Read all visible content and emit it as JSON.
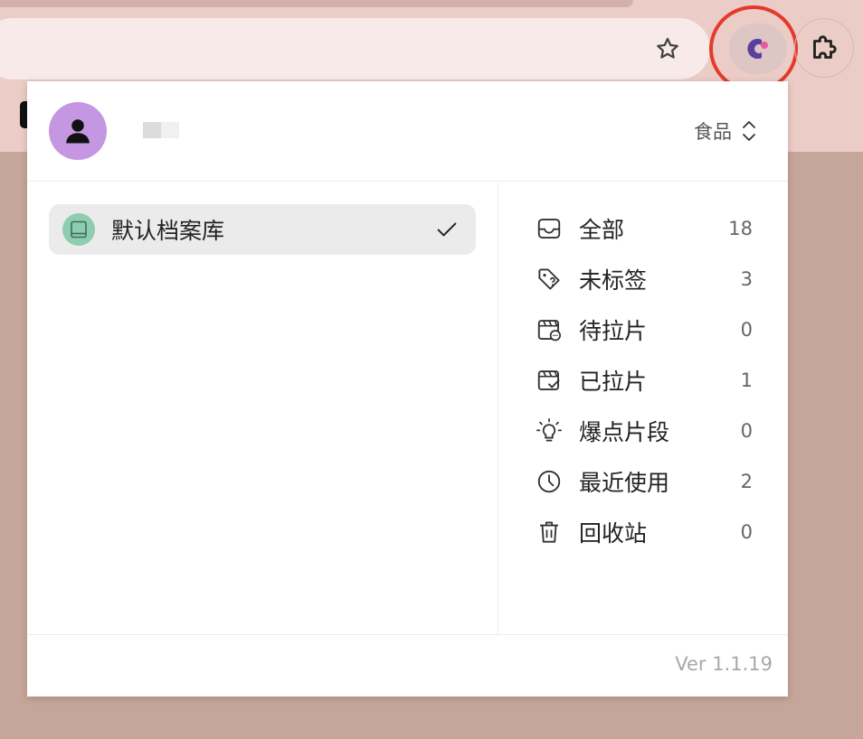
{
  "browser": {
    "bookmark_icon": "star-icon",
    "extension_icon": "extension-logo-icon",
    "extensions_menu_icon": "puzzle-icon",
    "highlight_color": "#e43a2b"
  },
  "header": {
    "avatar_icon": "person-icon",
    "avatar_color": "#c596e1",
    "category_select": {
      "value": "食品",
      "icon": "chevron-up-down-icon"
    }
  },
  "libraries": [
    {
      "label": "默认档案库",
      "selected": true,
      "icon": "book-icon",
      "icon_color": "#8ecdb0"
    }
  ],
  "categories": [
    {
      "label": "全部",
      "count": "18",
      "icon": "inbox-icon"
    },
    {
      "label": "未标签",
      "count": "3",
      "icon": "tag-question-icon"
    },
    {
      "label": "待拉片",
      "count": "0",
      "icon": "clapper-pending-icon"
    },
    {
      "label": "已拉片",
      "count": "1",
      "icon": "clapper-check-icon"
    },
    {
      "label": "爆点片段",
      "count": "0",
      "icon": "lightbulb-icon"
    },
    {
      "label": "最近使用",
      "count": "2",
      "icon": "clock-icon"
    },
    {
      "label": "回收站",
      "count": "0",
      "icon": "trash-icon"
    }
  ],
  "footer": {
    "version": "Ver 1.1.19"
  }
}
